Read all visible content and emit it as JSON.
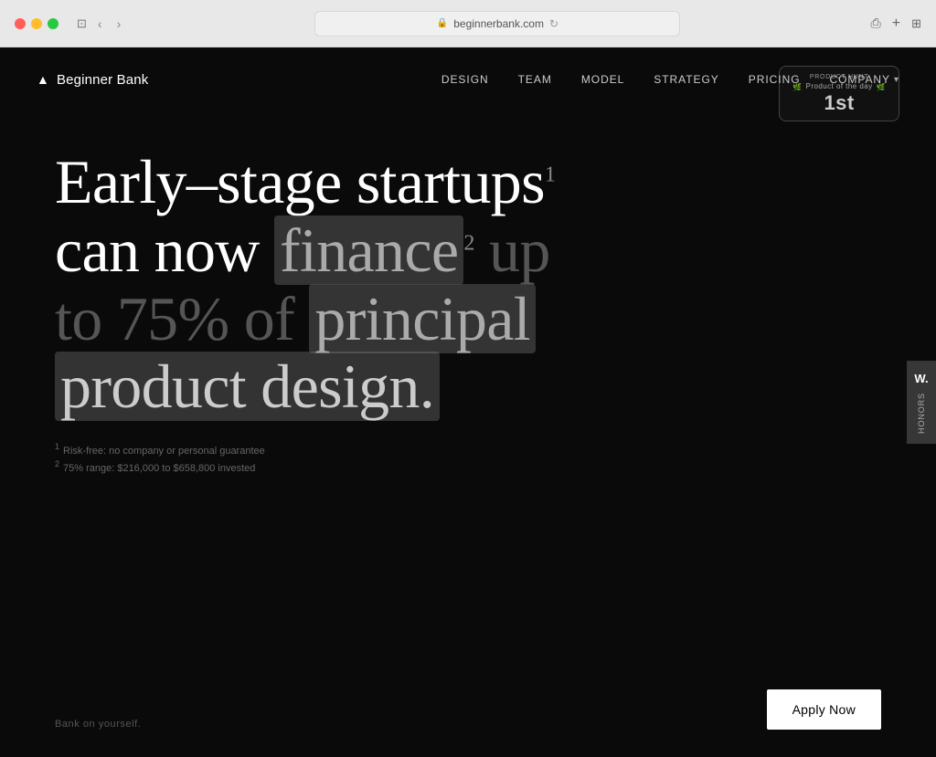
{
  "browser": {
    "url": "beginnerbank.com",
    "traffic_lights": [
      "red",
      "yellow",
      "green"
    ]
  },
  "nav": {
    "logo_icon": "▲",
    "logo_text": "Beginner Bank",
    "links": [
      {
        "label": "DESIGN",
        "id": "design"
      },
      {
        "label": "TEAM",
        "id": "team"
      },
      {
        "label": "MODEL",
        "id": "model"
      },
      {
        "label": "STRATEGY",
        "id": "strategy"
      },
      {
        "label": "PRICING",
        "id": "pricing"
      },
      {
        "label": "COMPANY",
        "id": "company",
        "has_dropdown": true
      }
    ]
  },
  "product_hunt": {
    "title": "PRODUCT HUNT",
    "subtitle": "Product of the day",
    "rank": "1st"
  },
  "hero": {
    "line1_part1": "Early–stage startups",
    "line1_sup": "1",
    "line2_part1": "can now",
    "line2_highlight": "finance",
    "line2_sup": "2",
    "line2_part2": "up",
    "line3": "to 75% of",
    "line3_highlight": "principal",
    "line4_highlight": "product design."
  },
  "footnotes": {
    "note1": "Risk-free: no company or personal guarantee",
    "note2": "75% range: $216,000 to $658,800 invested"
  },
  "side_panel": {
    "letter": "W.",
    "label": "Honors"
  },
  "footer": {
    "tagline": "Bank on yourself.",
    "apply_label": "Apply Now"
  }
}
